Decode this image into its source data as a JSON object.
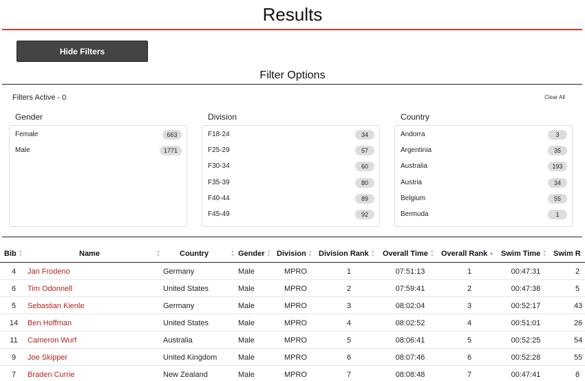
{
  "page": {
    "title": "Results"
  },
  "filters": {
    "toggle_label": "Hide Filters",
    "heading": "Filter Options",
    "active_label": "Filters Active - 0",
    "clear_all": "Clear All",
    "gender": {
      "title": "Gender",
      "items": [
        {
          "label": "Female",
          "count": "663"
        },
        {
          "label": "Male",
          "count": "1771"
        }
      ]
    },
    "division": {
      "title": "Division",
      "items": [
        {
          "label": "F18-24",
          "count": "34"
        },
        {
          "label": "F25-29",
          "count": "57"
        },
        {
          "label": "F30-34",
          "count": "60"
        },
        {
          "label": "F35-39",
          "count": "80"
        },
        {
          "label": "F40-44",
          "count": "89"
        },
        {
          "label": "F45-49",
          "count": "92"
        }
      ]
    },
    "country": {
      "title": "Country",
      "items": [
        {
          "label": "Andorra",
          "count": "3"
        },
        {
          "label": "Argentinia",
          "count": "35"
        },
        {
          "label": "Australia",
          "count": "193"
        },
        {
          "label": "Austria",
          "count": "34"
        },
        {
          "label": "Belgium",
          "count": "55"
        },
        {
          "label": "Bermuda",
          "count": "1"
        }
      ]
    }
  },
  "table": {
    "headers": {
      "bib": "Bib",
      "name": "Name",
      "country": "Country",
      "gender": "Gender",
      "division": "Division",
      "division_rank": "Division Rank",
      "overall_time": "Overall Time",
      "overall_rank": "Overall Rank",
      "swim_time": "Swim Time",
      "swim_rank": "Swim R"
    },
    "rows": [
      {
        "bib": "4",
        "name": "Jan Frodeno",
        "country": "Germany",
        "gender": "Male",
        "division": "MPRO",
        "division_rank": "1",
        "overall_time": "07:51:13",
        "overall_rank": "1",
        "swim_time": "00:47:31",
        "swim_rank": "2"
      },
      {
        "bib": "6",
        "name": "Tim Odonnell",
        "country": "United States",
        "gender": "Male",
        "division": "MPRO",
        "division_rank": "2",
        "overall_time": "07:59:41",
        "overall_rank": "2",
        "swim_time": "00:47:38",
        "swim_rank": "5"
      },
      {
        "bib": "5",
        "name": "Sebastian Kienle",
        "country": "Germany",
        "gender": "Male",
        "division": "MPRO",
        "division_rank": "3",
        "overall_time": "08:02:04",
        "overall_rank": "3",
        "swim_time": "00:52:17",
        "swim_rank": "43"
      },
      {
        "bib": "14",
        "name": "Ben Hoffman",
        "country": "United States",
        "gender": "Male",
        "division": "MPRO",
        "division_rank": "4",
        "overall_time": "08:02:52",
        "overall_rank": "4",
        "swim_time": "00:51:01",
        "swim_rank": "26"
      },
      {
        "bib": "11",
        "name": "Cameron Wurf",
        "country": "Australia",
        "gender": "Male",
        "division": "MPRO",
        "division_rank": "5",
        "overall_time": "08:06:41",
        "overall_rank": "5",
        "swim_time": "00:52:25",
        "swim_rank": "54"
      },
      {
        "bib": "9",
        "name": "Joe Skipper",
        "country": "United Kingdom",
        "gender": "Male",
        "division": "MPRO",
        "division_rank": "6",
        "overall_time": "08:07:46",
        "overall_rank": "6",
        "swim_time": "00:52:28",
        "swim_rank": "55"
      },
      {
        "bib": "7",
        "name": "Braden Currie",
        "country": "New Zealand",
        "gender": "Male",
        "division": "MPRO",
        "division_rank": "7",
        "overall_time": "08:08:48",
        "overall_rank": "7",
        "swim_time": "00:47:41",
        "swim_rank": "8"
      }
    ]
  }
}
